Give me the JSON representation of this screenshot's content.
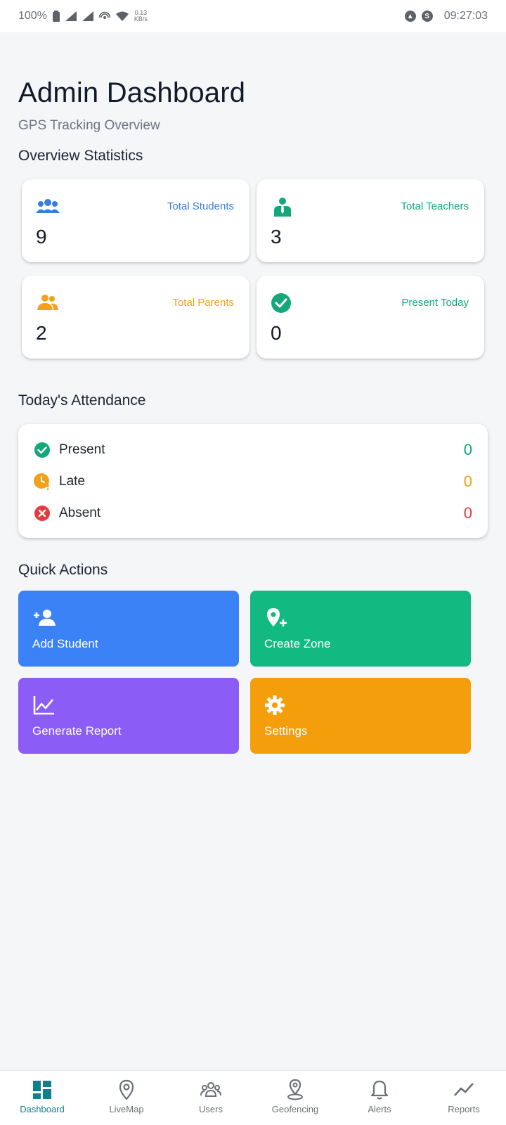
{
  "status_bar": {
    "battery": "100%",
    "net_speed_value": "0.13",
    "net_speed_unit": "KB/s",
    "time": "09:27:03"
  },
  "header": {
    "title": "Admin Dashboard",
    "subtitle": "GPS Tracking Overview"
  },
  "overview": {
    "section_title": "Overview Statistics",
    "cards": [
      {
        "label": "Total Students",
        "value": "9",
        "color": "#3b7ddd",
        "icon": "people-group-icon"
      },
      {
        "label": "Total Teachers",
        "value": "3",
        "color": "#13a779",
        "icon": "teacher-icon"
      },
      {
        "label": "Total Parents",
        "value": "2",
        "color": "#f0a21a",
        "icon": "people-icon"
      },
      {
        "label": "Present Today",
        "value": "0",
        "color": "#13a779",
        "icon": "check-circle-icon"
      }
    ]
  },
  "attendance": {
    "section_title": "Today's Attendance",
    "rows": [
      {
        "label": "Present",
        "value": "0",
        "color": "#13a779",
        "icon": "check-circle-icon"
      },
      {
        "label": "Late",
        "value": "0",
        "color": "#f0a21a",
        "icon": "clock-alert-icon"
      },
      {
        "label": "Absent",
        "value": "0",
        "color": "#e33b3b",
        "icon": "x-circle-icon"
      }
    ]
  },
  "quick_actions": {
    "section_title": "Quick Actions",
    "items": [
      {
        "label": "Add Student",
        "color": "#3b82f6",
        "icon": "add-person-icon"
      },
      {
        "label": "Create Zone",
        "color": "#12b981",
        "icon": "add-location-icon"
      },
      {
        "label": "Generate Report",
        "color": "#8b5cf6",
        "icon": "chart-line-icon"
      },
      {
        "label": "Settings",
        "color": "#f59e0b",
        "icon": "gear-icon"
      }
    ]
  },
  "bottom_nav": {
    "active": "Dashboard",
    "active_color": "#12808c",
    "items": [
      {
        "label": "Dashboard",
        "icon": "dashboard-icon"
      },
      {
        "label": "LiveMap",
        "icon": "map-pin-icon"
      },
      {
        "label": "Users",
        "icon": "users-icon"
      },
      {
        "label": "Geofencing",
        "icon": "geofence-icon"
      },
      {
        "label": "Alerts",
        "icon": "bell-icon"
      },
      {
        "label": "Reports",
        "icon": "trend-icon"
      }
    ]
  }
}
